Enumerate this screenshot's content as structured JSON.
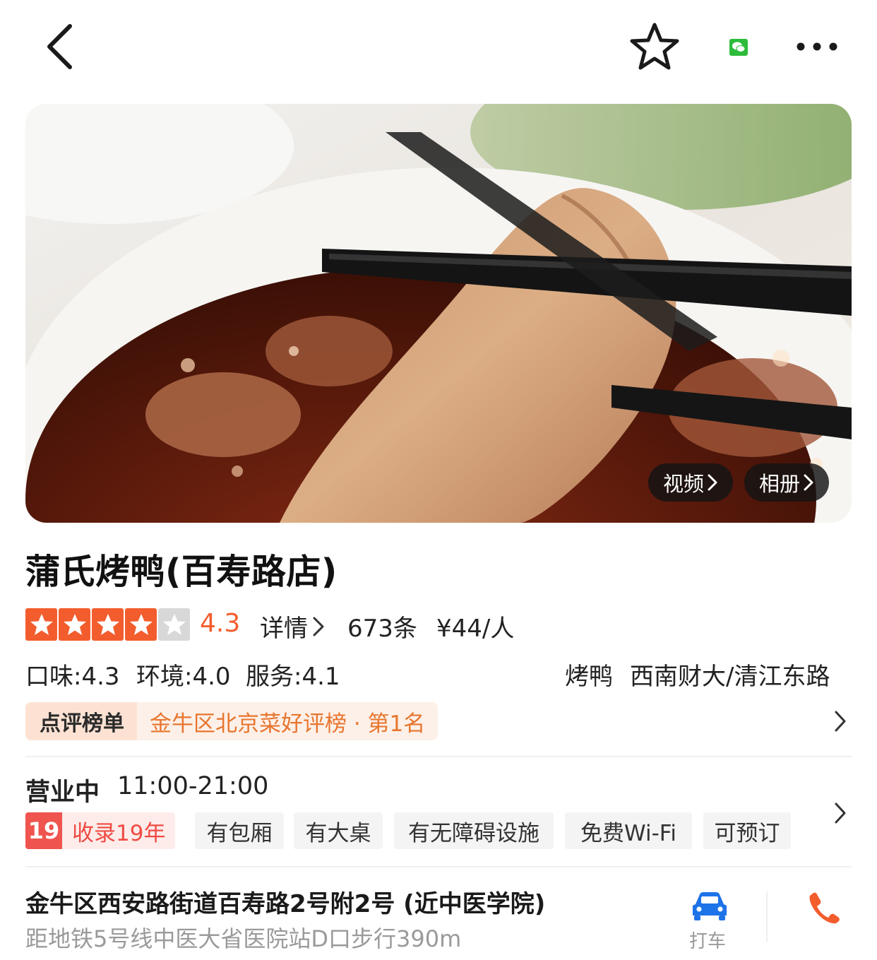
{
  "top_bar": {
    "back_icon": "chevron-left-icon",
    "favorite_icon": "star-outline-icon",
    "wechat_icon": "wechat-icon",
    "more_icon": "more-dots-icon"
  },
  "hero": {
    "image_subject": "roast-duck-with-chopsticks",
    "video_label": "视频",
    "album_label": "相册"
  },
  "shop": {
    "name": "蒲氏烤鸭(百寿路店)",
    "stars": 4,
    "rating": "4.3",
    "details_label": "详情",
    "review_count": "673条",
    "price_per_person": "¥44/人",
    "scores": {
      "taste": "口味:4.3",
      "environment": "环境:4.0",
      "service": "服务:4.1"
    },
    "category": "烤鸭",
    "area": "西南财大/清江东路"
  },
  "ranking": {
    "label": "点评榜单",
    "text": "金牛区北京菜好评榜 · 第1名"
  },
  "business": {
    "status": "营业中",
    "hours": "11:00-21:00",
    "years_number": "19",
    "years_text": "收录19年",
    "tags": [
      "有包厢",
      "有大桌",
      "有无障碍设施",
      "免费Wi-Fi",
      "可预订"
    ]
  },
  "address": {
    "line": "金牛区西安路街道百寿路2号附2号 (近中医学院)",
    "distance": "距地铁5号线中医大省医院站D口步行390m",
    "taxi_label": "打车",
    "taxi_icon": "car-icon",
    "phone_icon": "phone-icon"
  },
  "colors": {
    "accent_orange": "#f35d2d",
    "rank_orange": "#e8752e",
    "years_red": "#ef4b43",
    "car_blue": "#1e73e8"
  }
}
